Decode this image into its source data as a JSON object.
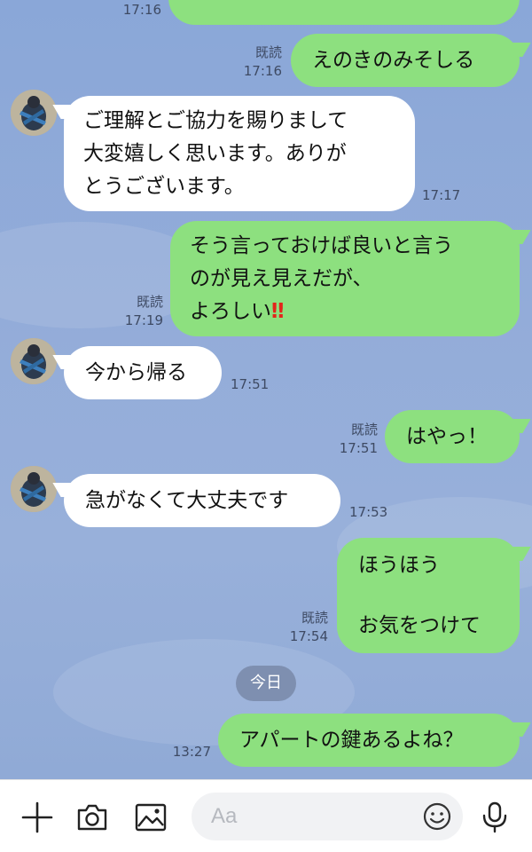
{
  "messages": {
    "m0": {
      "time": "17:16"
    },
    "m1": {
      "text": "えのきのみそしる",
      "read": "既読",
      "time": "17:16"
    },
    "m2": {
      "text": "ご理解とご協力を賜りまして\n大変嬉しく思います。ありが\nとうございます。",
      "time": "17:17"
    },
    "m3": {
      "text_line1": "そう言っておけば良いと言う",
      "text_line2": "のが見え見えだが、",
      "text_line3": "よろしい",
      "emoji": "‼",
      "read": "既読",
      "time": "17:19"
    },
    "m4": {
      "text": "今から帰る",
      "time": "17:51"
    },
    "m5": {
      "text": "はやっ！",
      "read": "既読",
      "time": "17:51"
    },
    "m6": {
      "text": "急がなくて大丈夫です",
      "time": "17:53"
    },
    "m7": {
      "text_line1": "ほうほう",
      "text_line2": "お気をつけて",
      "read": "既読",
      "time": "17:54"
    },
    "date_chip": "今日",
    "m8": {
      "text": "アパートの鍵あるよね？",
      "time": "13:27"
    }
  },
  "input_bar": {
    "placeholder": "Aa",
    "icons": [
      "plus-icon",
      "camera-icon",
      "image-icon",
      "emoji-icon",
      "microphone-icon"
    ]
  },
  "colors": {
    "background": "#8ea9d6",
    "outgoing_bubble": "#8de07f",
    "incoming_bubble": "#ffffff",
    "date_chip": "#7888a8"
  }
}
